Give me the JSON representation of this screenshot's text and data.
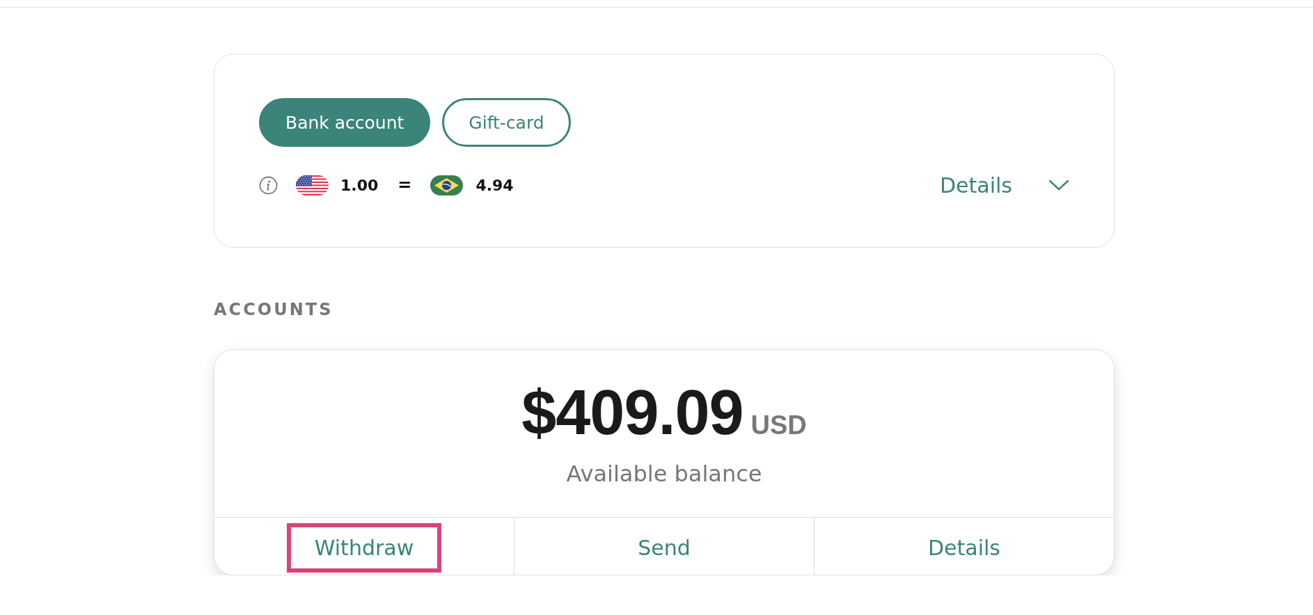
{
  "transfer_types": [
    {
      "label": "Bank account",
      "selected": true
    },
    {
      "label": "Gift-card",
      "selected": false
    }
  ],
  "exchange_rate": {
    "from_amount": "1.00",
    "equals_sign": "=",
    "to_amount": "4.94",
    "details_toggle": {
      "label": "Details",
      "expanded": false
    }
  },
  "accounts_section": {
    "heading": "ACCOUNTS",
    "account": {
      "balance": "$409.09",
      "currency": "USD",
      "caption": "Available balance",
      "actions": [
        {
          "label": "Withdraw",
          "highlighted": true
        },
        {
          "label": "Send",
          "highlighted": false
        },
        {
          "label": "Details",
          "highlighted": false
        }
      ]
    }
  }
}
